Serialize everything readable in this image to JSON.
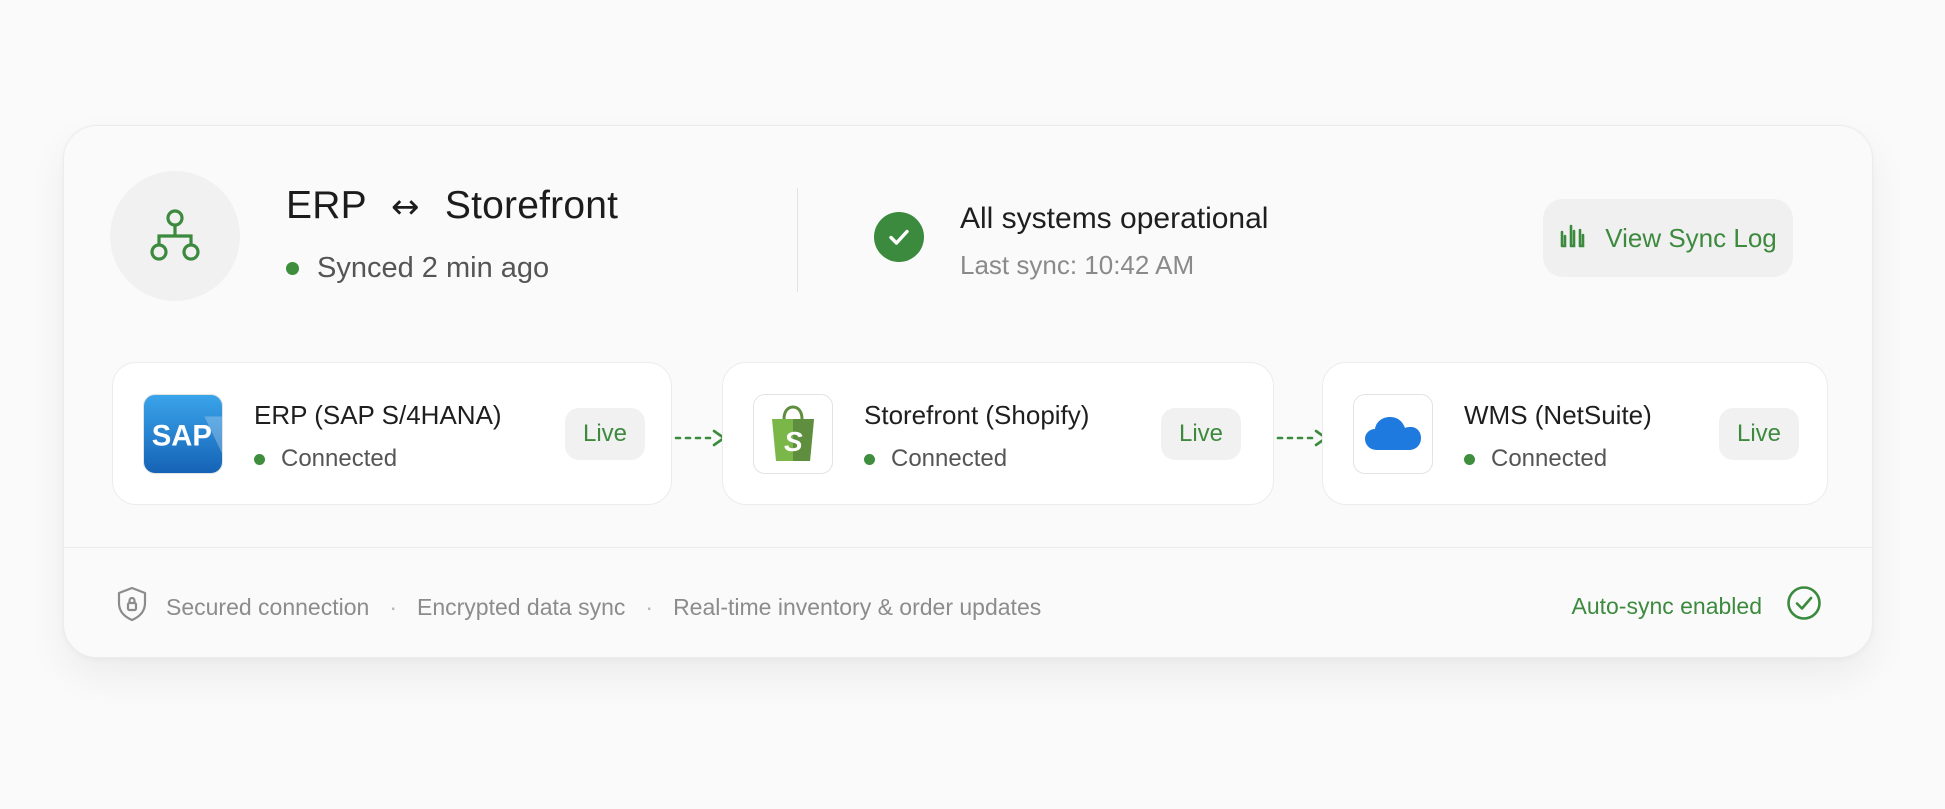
{
  "header": {
    "title_left": "ERP",
    "title_arrow": "↔",
    "title_right": "Storefront",
    "sync_text": "Synced 2 min ago",
    "status_title": "All systems operational",
    "last_sync": "Last sync: 10:42 AM",
    "log_button_label": "View Sync Log"
  },
  "systems": [
    {
      "name": "ERP (SAP S/4HANA)",
      "status": "Connected",
      "badge": "Live",
      "logo": "sap-logo"
    },
    {
      "name": "Storefront (Shopify)",
      "status": "Connected",
      "badge": "Live",
      "logo": "shopify-logo"
    },
    {
      "name": "WMS (NetSuite)",
      "status": "Connected",
      "badge": "Live",
      "logo": "cloud-icon"
    }
  ],
  "logos": {
    "sap_text": "SAP",
    "shopify_letter": "S"
  },
  "footer": {
    "items": [
      "Secured connection",
      "Encrypted data sync",
      "Real-time inventory & order updates"
    ],
    "separator": "·",
    "auto_sync": "Auto-sync enabled"
  },
  "colors": {
    "accent_green": "#3b8a3e",
    "status_dot": "#3e8e3e",
    "sap_blue": "#1d6fc4",
    "shopify_green": "#7ab648",
    "cloud_blue": "#1f7ae0"
  }
}
